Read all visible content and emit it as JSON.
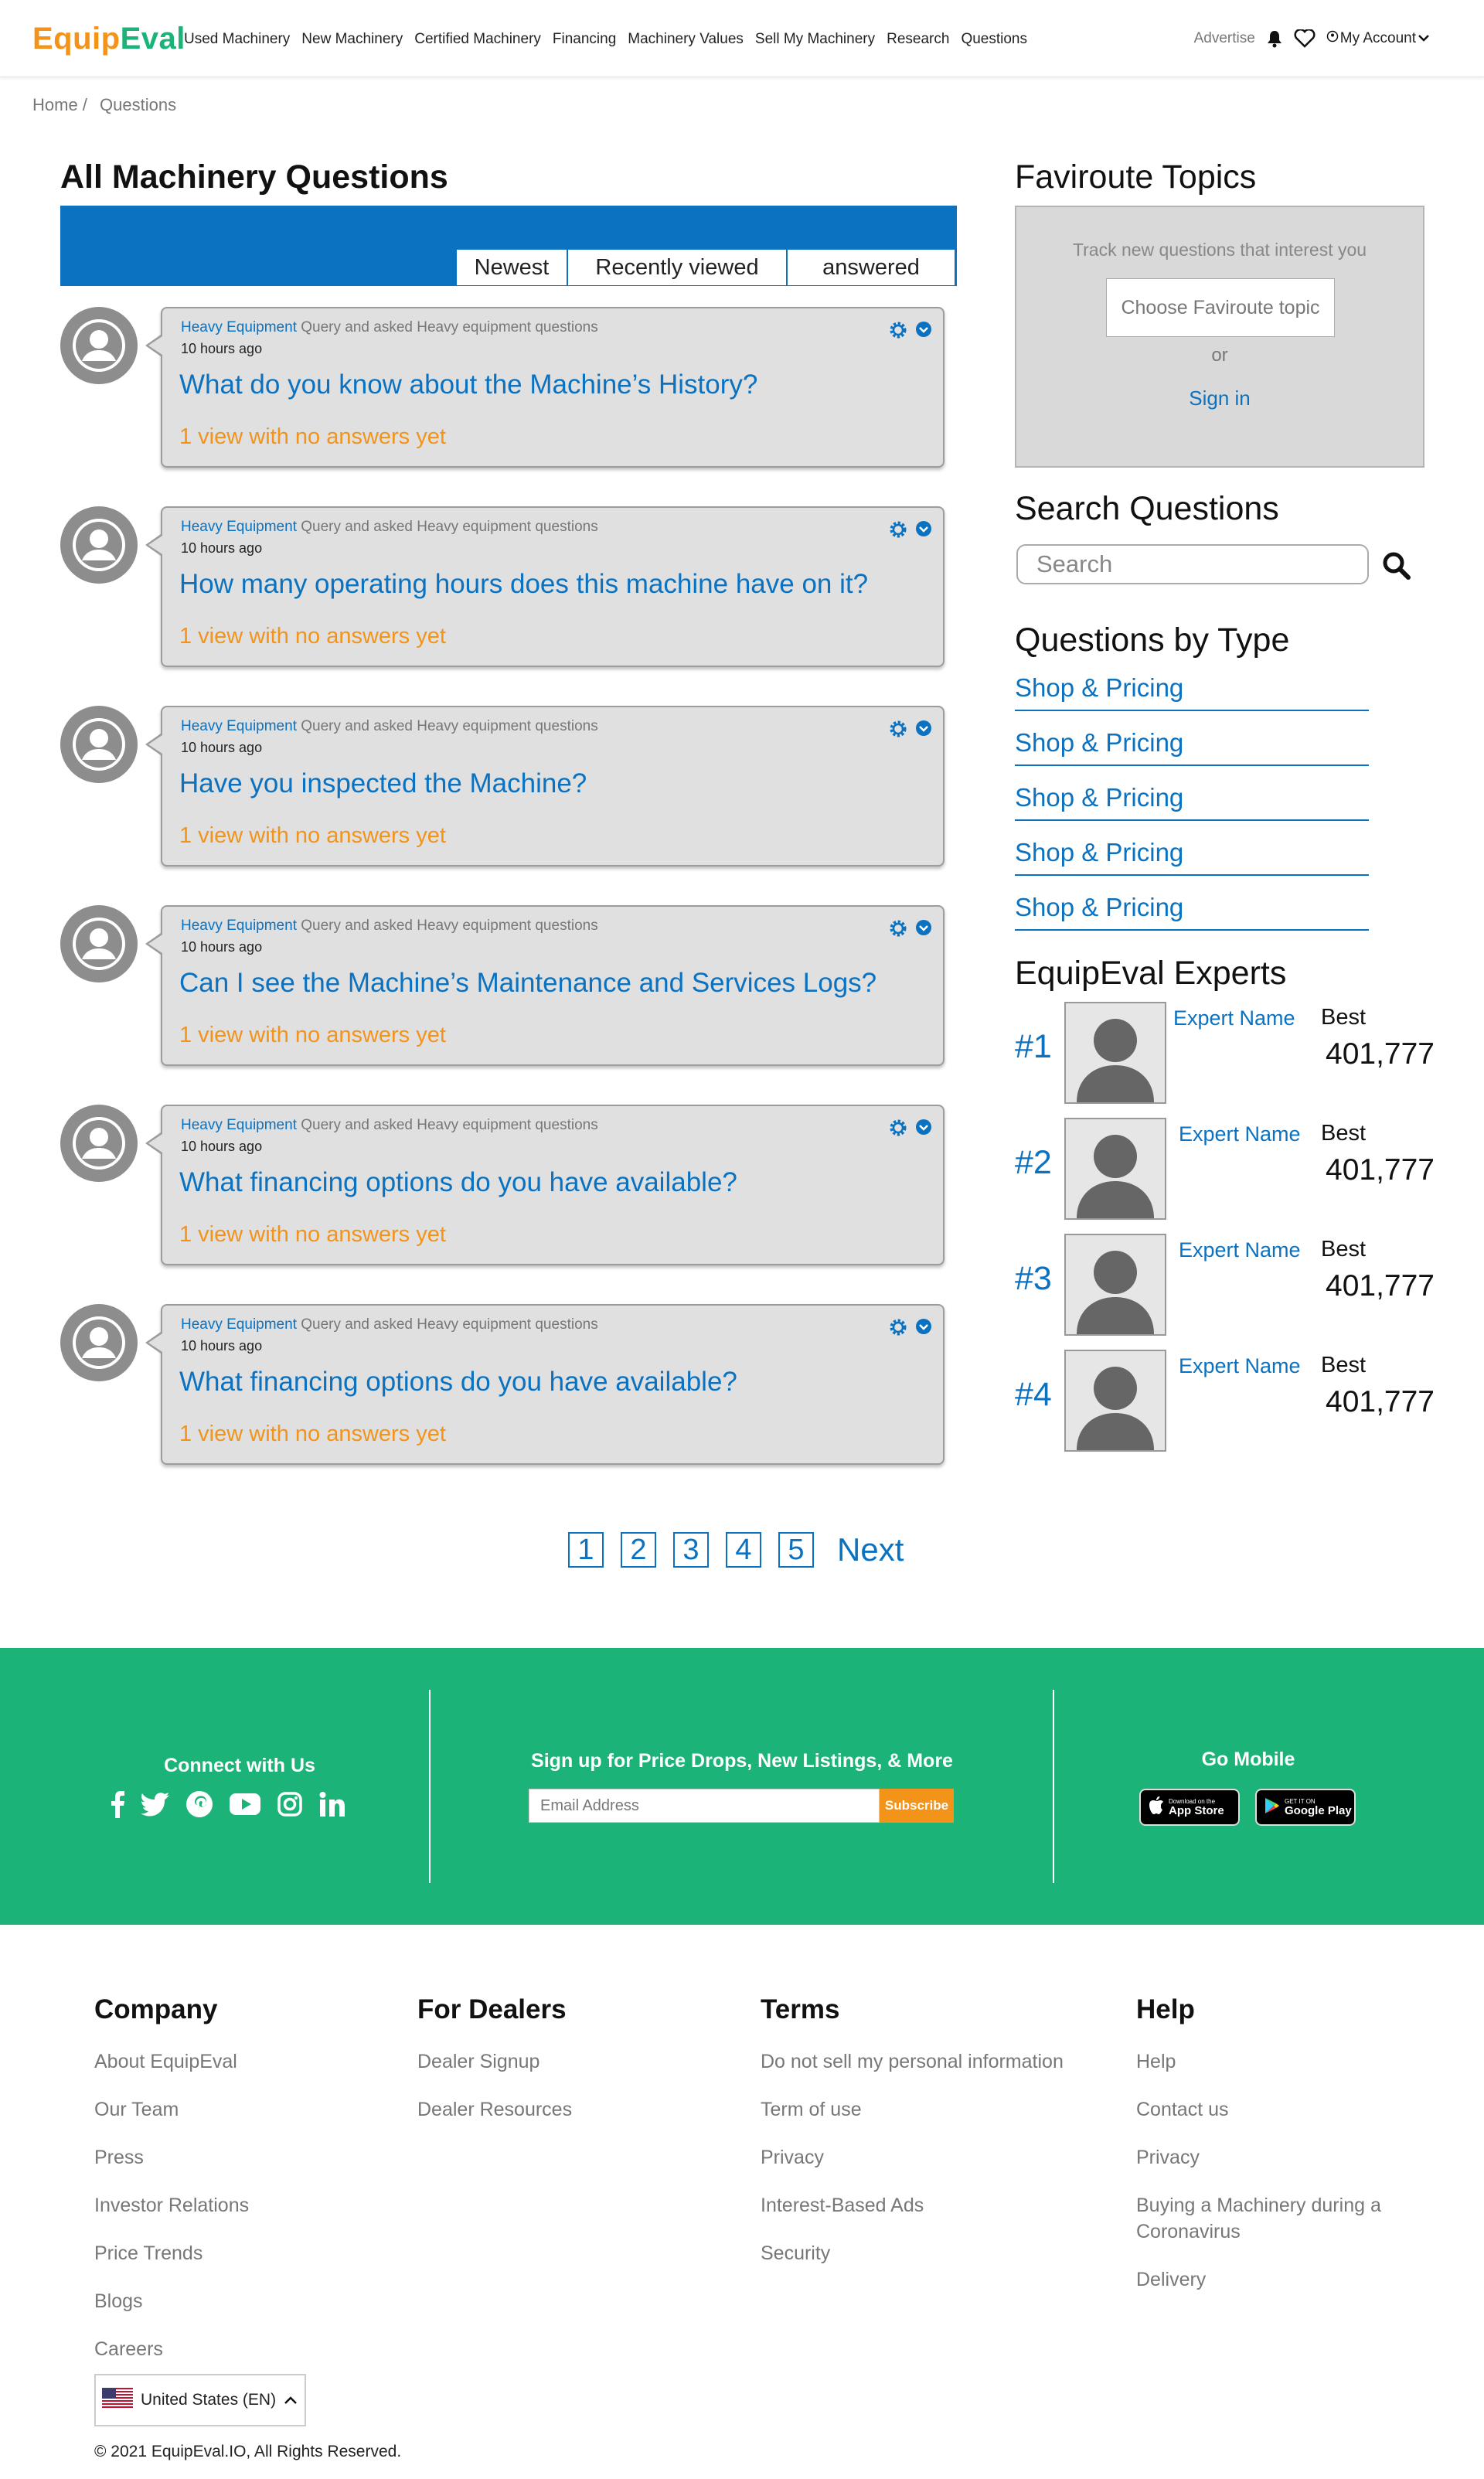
{
  "header": {
    "logo_part1": "Equip",
    "logo_part2": "Eval",
    "nav": [
      "Used Machinery",
      "New Machinery",
      "Certified Machinery",
      "Financing",
      "Machinery Values",
      "Sell My Machinery",
      "Research",
      "Questions"
    ],
    "advertise": "Advertise",
    "account": "My Account"
  },
  "breadcrumb": {
    "home": "Home /",
    "current": "Questions"
  },
  "questions": {
    "title": "All Machinery Questions",
    "tabs": [
      "Newest",
      "Recently viewed",
      "answered"
    ],
    "items": [
      {
        "category": "Heavy Equipment",
        "meta": " Query and asked Heavy equipment questions",
        "time": "10 hours ago",
        "question": "What do you know about the Machine’s History?",
        "views": "1 view with no answers yet"
      },
      {
        "category": "Heavy Equipment",
        "meta": " Query and asked Heavy equipment questions",
        "time": "10 hours ago",
        "question": "How many operating hours does this machine have on it?",
        "views": "1 view with no answers yet"
      },
      {
        "category": "Heavy Equipment",
        "meta": " Query and asked Heavy equipment questions",
        "time": "10 hours ago",
        "question": "Have you inspected the Machine?",
        "views": "1 view with no answers yet"
      },
      {
        "category": "Heavy Equipment",
        "meta": " Query and asked Heavy equipment questions",
        "time": "10 hours ago",
        "question": "Can I see the Machine’s Maintenance and Services Logs?",
        "views": "1 view with no answers yet"
      },
      {
        "category": "Heavy Equipment",
        "meta": " Query and asked Heavy equipment questions",
        "time": "10 hours ago",
        "question": "What financing options do you have available?",
        "views": "1 view with no answers yet"
      },
      {
        "category": "Heavy Equipment",
        "meta": " Query and asked Heavy equipment questions",
        "time": "10 hours ago",
        "question": "What financing options do you have available?",
        "views": "1 view with no answers yet"
      }
    ]
  },
  "pagination": {
    "pages": [
      "1",
      "2",
      "3",
      "4",
      "5"
    ],
    "next": "Next"
  },
  "sidebar": {
    "topics_title": "Faviroute Topics",
    "topics_prompt": "Track new questions that interest you",
    "choose_topic": "Choose Faviroute topic",
    "or": "or",
    "sign_in": "Sign in",
    "search_title": "Search Questions",
    "search_placeholder": "Search",
    "types_title": "Questions by Type",
    "types": [
      "Shop & Pricing",
      "Shop & Pricing",
      "Shop & Pricing",
      "Shop & Pricing",
      "Shop & Pricing"
    ],
    "experts_title": "EquipEval Experts",
    "experts": [
      {
        "rank": "#1",
        "name": "Expert Name",
        "label": "Best",
        "score": "401,777"
      },
      {
        "rank": "#2",
        "name": "Expert Name",
        "label": "Best",
        "score": "401,777"
      },
      {
        "rank": "#3",
        "name": "Expert Name",
        "label": "Best",
        "score": "401,777"
      },
      {
        "rank": "#4",
        "name": "Expert Name",
        "label": "Best",
        "score": "401,777"
      }
    ]
  },
  "band": {
    "connect_title": "Connect with Us",
    "signup_title": "Sign up for Price Drops, New Listings, & More",
    "email_placeholder": "Email Address",
    "subscribe": "Subscribe",
    "mobile_title": "Go Mobile",
    "appstore_small": "Download on the",
    "appstore_big": "App Store",
    "googleplay_small": "GET IT ON",
    "googleplay_big": "Google Play"
  },
  "footer": {
    "company": {
      "title": "Company",
      "links": [
        "About EquipEval",
        "Our Team",
        "Press",
        "Investor Relations",
        "Price Trends",
        "Blogs",
        "Careers"
      ]
    },
    "dealers": {
      "title": "For Dealers",
      "links": [
        "Dealer Signup",
        "Dealer Resources"
      ]
    },
    "terms": {
      "title": "Terms",
      "links": [
        "Do not sell my personal information",
        "Term of use",
        "Privacy",
        "Interest-Based Ads",
        "Security"
      ]
    },
    "help": {
      "title": "Help",
      "links": [
        "Help",
        "Contact us",
        "Privacy",
        "Buying a Machinery during a Coronavirus",
        "Delivery"
      ]
    },
    "language": "United States (EN)",
    "copyright": "© 2021 EquipEval.IO, All Rights Reserved."
  },
  "colors": {
    "brand_blue": "#0a72c1",
    "brand_orange": "#f39319",
    "brand_green": "#1bb377"
  }
}
